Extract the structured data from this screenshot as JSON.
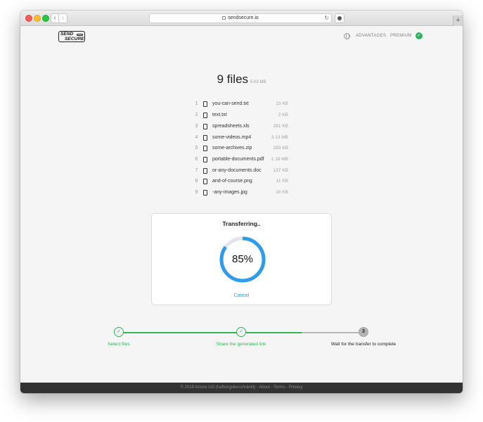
{
  "browser": {
    "url": "sendsecure.io"
  },
  "header": {
    "logo_line1": "SEND",
    "logo_line2": "SECURE",
    "nav": [
      {
        "label": "ADVANTAGES"
      },
      {
        "label": "PREMIUM"
      }
    ]
  },
  "files": {
    "count_label": "9 files",
    "total_size": "5.03 MB",
    "items": [
      {
        "num": "1",
        "name": "you-can-send.txt",
        "size": "23 KB"
      },
      {
        "num": "2",
        "name": "text.txt",
        "size": "2 KB"
      },
      {
        "num": "3",
        "name": "spreadsheets.xls",
        "size": "281 KB"
      },
      {
        "num": "4",
        "name": "some-videos.mp4",
        "size": "3.13 MB"
      },
      {
        "num": "5",
        "name": "some-archives.zip",
        "size": "283 KB"
      },
      {
        "num": "6",
        "name": "portable-documents.pdf",
        "size": "1.18 MB"
      },
      {
        "num": "7",
        "name": "or-any-documents.doc",
        "size": "137 KB"
      },
      {
        "num": "8",
        "name": "and-of-course.png",
        "size": "11 KB"
      },
      {
        "num": "9",
        "name": "-any-images.jpg",
        "size": "18 KB"
      }
    ]
  },
  "transfer": {
    "title": "Transferring..",
    "percent_label": "85%",
    "progress": 0.85,
    "cancel_label": "Cancel"
  },
  "steps": [
    {
      "label": "Select files",
      "state": "done",
      "marker": "✓"
    },
    {
      "label": "Share the generated link",
      "state": "done",
      "marker": "✓"
    },
    {
      "label": "Wait for the transfer to complete",
      "state": "current",
      "marker": "3"
    }
  ],
  "footer": {
    "text": "© 2019 Acture UG (haftungsbeschränkt) - About - Terms - Privacy"
  },
  "colors": {
    "accent_green": "#35b559",
    "accent_blue": "#2d9bee",
    "ring_track": "#e3e5ec"
  }
}
